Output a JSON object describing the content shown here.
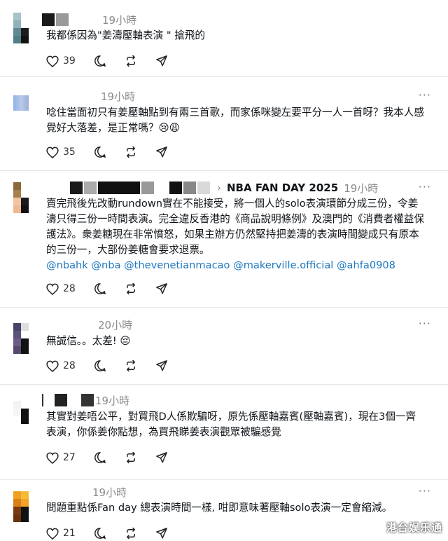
{
  "posts": [
    {
      "time": "19小時",
      "text": "我都係因為\"姜濤壓軸表演 \" 搶飛的",
      "likes": "39"
    },
    {
      "time": "19小時",
      "text": "唸住當面初只有姜壓軸點到有兩三首歌，而家係咪變左要平分一人一首呀？我本人感覺好大落差，是正常嗎？😢😩",
      "likes": "35"
    },
    {
      "time": "19小時",
      "reply_to": "NBA FAN DAY 2025",
      "text": "賣完飛後先改動rundown實在不能接受，將一個人的solo表演環節分成三份，令姜濤只得三份一時間表演。完全違反香港的《商品說明條例》及澳門的《消費者權益保護法》。衆姜糖現在非常憤怒，如果主辦方仍然堅持把姜濤的表演時間變成只有原本的三份一，大部份姜糖會要求退票。",
      "mentions": "@nbahk @nba @thevenetianmacao @makerville.official @ahfa0908",
      "likes": "28"
    },
    {
      "time": "20小時",
      "text": "無誠信。。太差! 😔",
      "likes": "28"
    },
    {
      "time": "19小時",
      "text": "其實對姜唔公平，對買飛D人係欺騙呀，原先係壓軸嘉賓(壓軸嘉賓)，現在3個一齊表演，你係姜你點想，為買飛睇姜表演觀眾被騙感覺",
      "likes": "27"
    },
    {
      "time": "19小時",
      "text": "問題重點係Fan day 總表演時間一樣, 咁即意味著壓軸solo表演一定會縮減。",
      "likes": "21"
    }
  ],
  "icons": [
    "heart-icon",
    "comment-icon",
    "repost-icon",
    "share-icon",
    "more-icon"
  ],
  "watermark": "港台娱乐通",
  "colors": {
    "link": "#1d77c0",
    "text": "#0f1419",
    "muted": "#8a8a8a"
  }
}
